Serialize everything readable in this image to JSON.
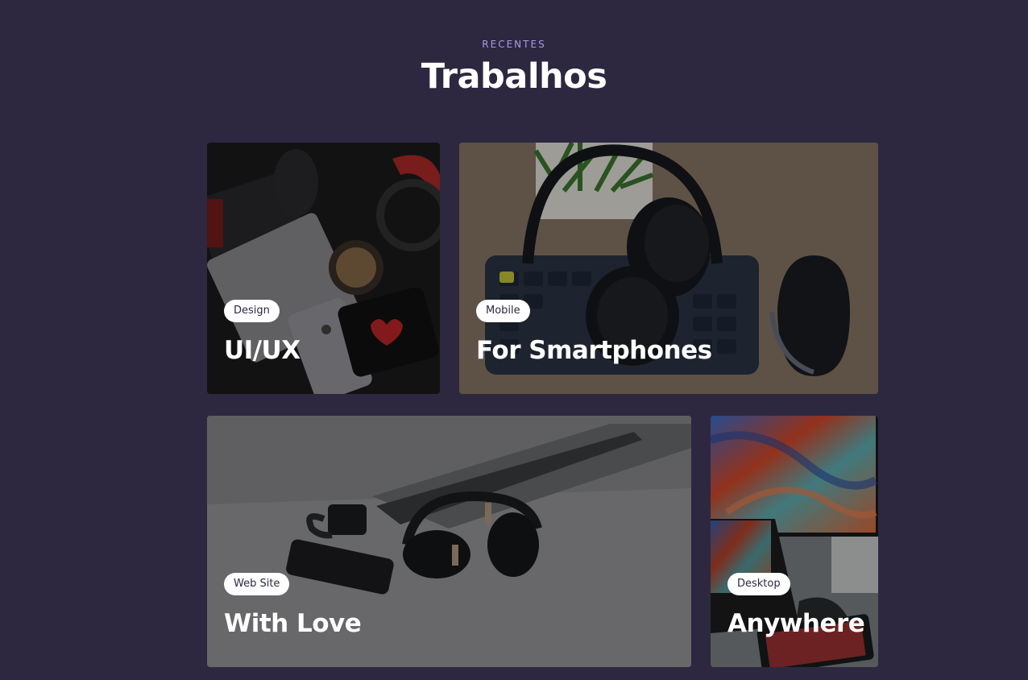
{
  "section": {
    "eyebrow": "RECENTES",
    "title": "Trabalhos"
  },
  "cards": [
    {
      "tag": "Design",
      "title": "UI/UX",
      "image": "flatlay-phone-headphones-photo"
    },
    {
      "tag": "Mobile",
      "title": "For Smartphones",
      "image": "headphones-keyboard-mouse-photo"
    },
    {
      "tag": "Web Site",
      "title": "With Love",
      "image": "laptop-headphones-desk-photo"
    },
    {
      "tag": "Desktop",
      "title": "Anywhere",
      "image": "monitor-laptop-workspace-photo"
    }
  ],
  "colors": {
    "background": "#2d2840",
    "eyebrow": "#a79ce6",
    "tag_bg": "#ffffff",
    "tag_text": "#2d2840"
  }
}
